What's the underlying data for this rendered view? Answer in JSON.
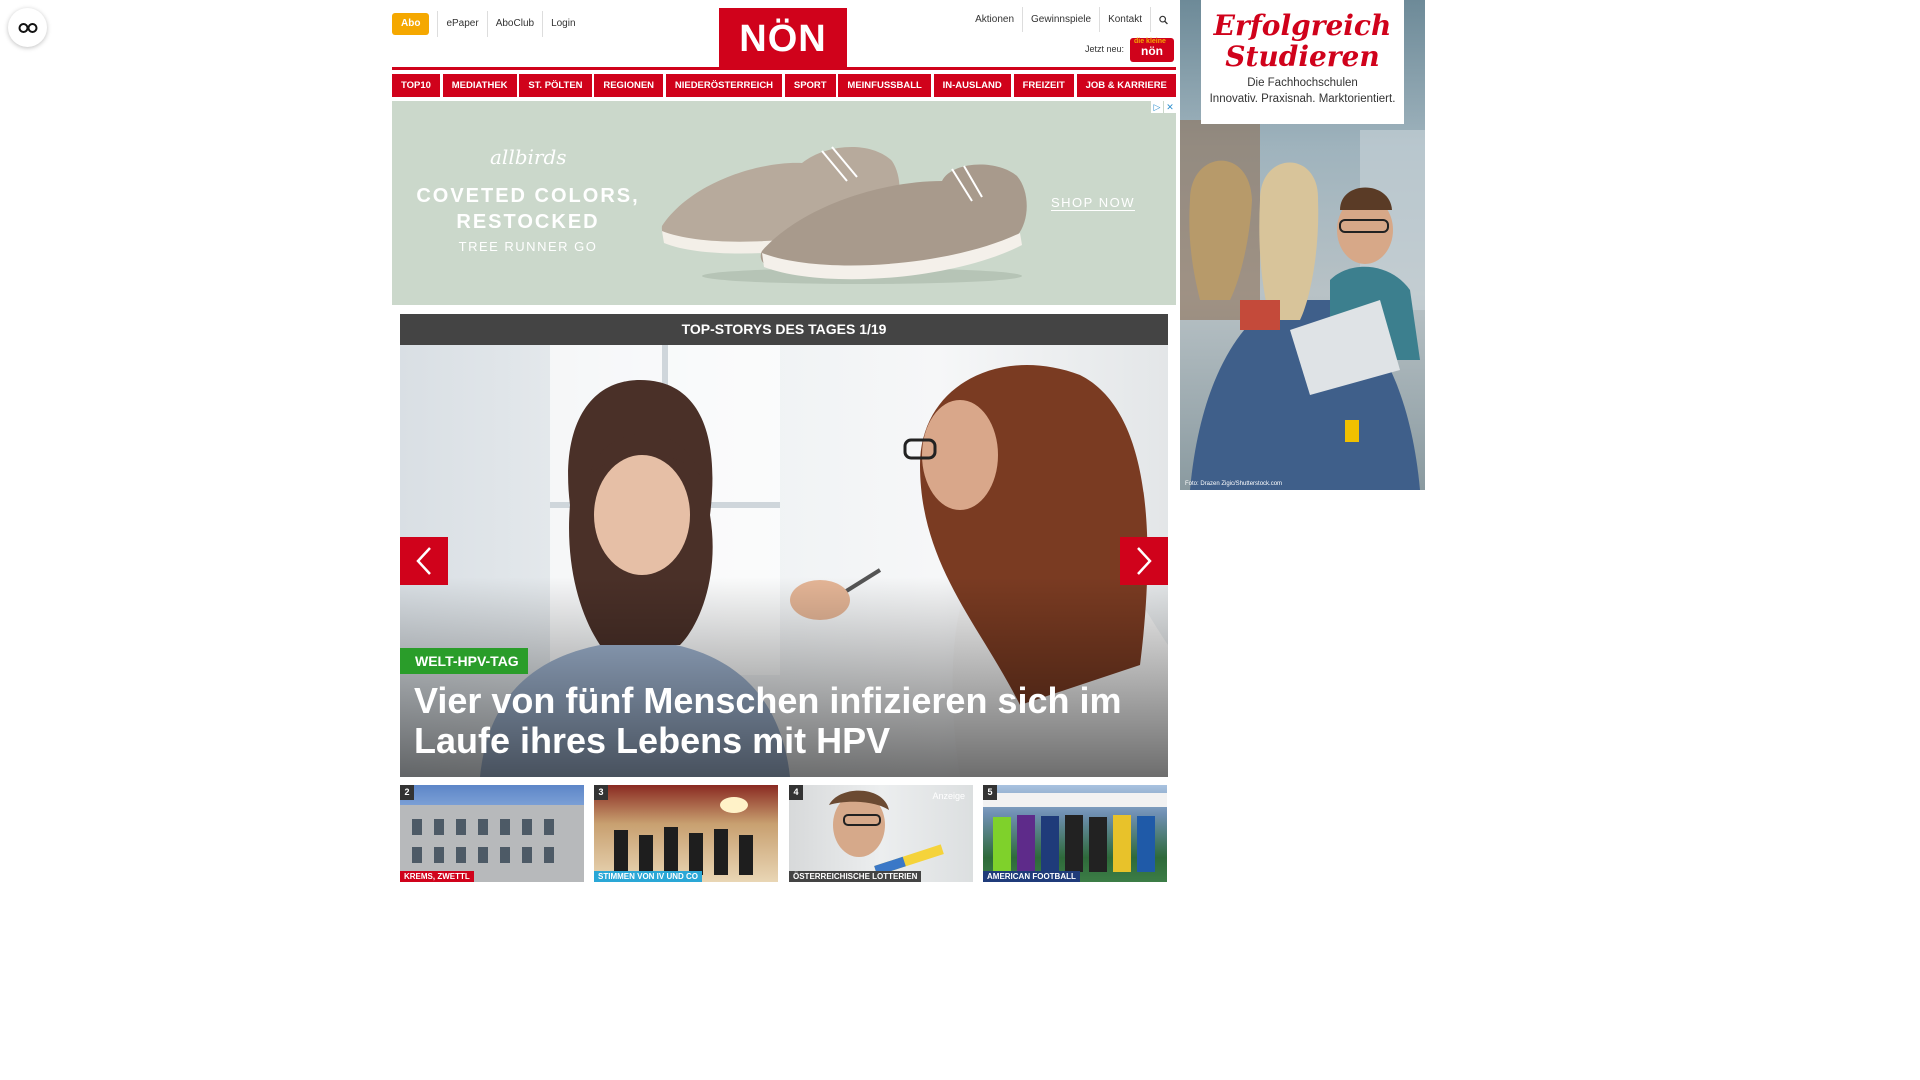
{
  "accessibility": {
    "icon": "glasses-icon"
  },
  "header": {
    "abo_label": "Abo",
    "links_left": [
      "ePaper",
      "AboClub",
      "Login"
    ],
    "logo_text": "NÖN",
    "links_right": [
      "Aktionen",
      "Gewinnspiele",
      "Kontakt"
    ],
    "search_icon": "search-icon",
    "jetzt_neu": "Jetzt neu:",
    "badge_small": "die kleine",
    "badge_main": "nön"
  },
  "nav": {
    "items": [
      "TOP10",
      "MEDIATHEK",
      "ST. PÖLTEN",
      "REGIONEN",
      "NIEDERÖSTERREICH",
      "SPORT",
      "MEINFUSSBALL",
      "IN-AUSLAND",
      "FREIZEIT",
      "JOB & KARRIERE"
    ]
  },
  "ad_banner": {
    "brand": "allbirds",
    "headline": "COVETED COLORS, RESTOCKED",
    "subline": "TREE RUNNER GO",
    "cta": "SHOP NOW",
    "choices_icons": [
      "adchoices-icon",
      "close-icon"
    ]
  },
  "top_stories": {
    "bar_title": "TOP-STORYS DES TAGES 1/19",
    "hero_tag": "WELT-HPV-TAG",
    "hero_title": "Vier von fünf Menschen infizieren sich im Laufe ihres Lebens mit HPV",
    "prev_icon": "chevron-left-icon",
    "next_icon": "chevron-right-icon",
    "teasers": [
      {
        "num": "2",
        "tag": "KREMS, ZWETTL",
        "anzeige": ""
      },
      {
        "num": "3",
        "tag": "STIMMEN VON IV UND CO",
        "anzeige": ""
      },
      {
        "num": "4",
        "tag": "ÖSTERREICHISCHE LOTTERIEN",
        "anzeige": "Anzeige"
      },
      {
        "num": "5",
        "tag": "AMERICAN FOOTBALL",
        "anzeige": ""
      }
    ]
  },
  "side_ad": {
    "headline": "Erfolgreich Studieren",
    "sub1": "Die Fachhochschulen",
    "sub2": "Innovativ. Praxisnah. Marktorientiert.",
    "foto": "Foto: Drazen Zigic/Shutterstock.com"
  },
  "colors": {
    "brand_red": "#d0021b",
    "abo_orange": "#f5a800",
    "tag_green": "#2a9d2a",
    "bar_grey": "#444444"
  }
}
